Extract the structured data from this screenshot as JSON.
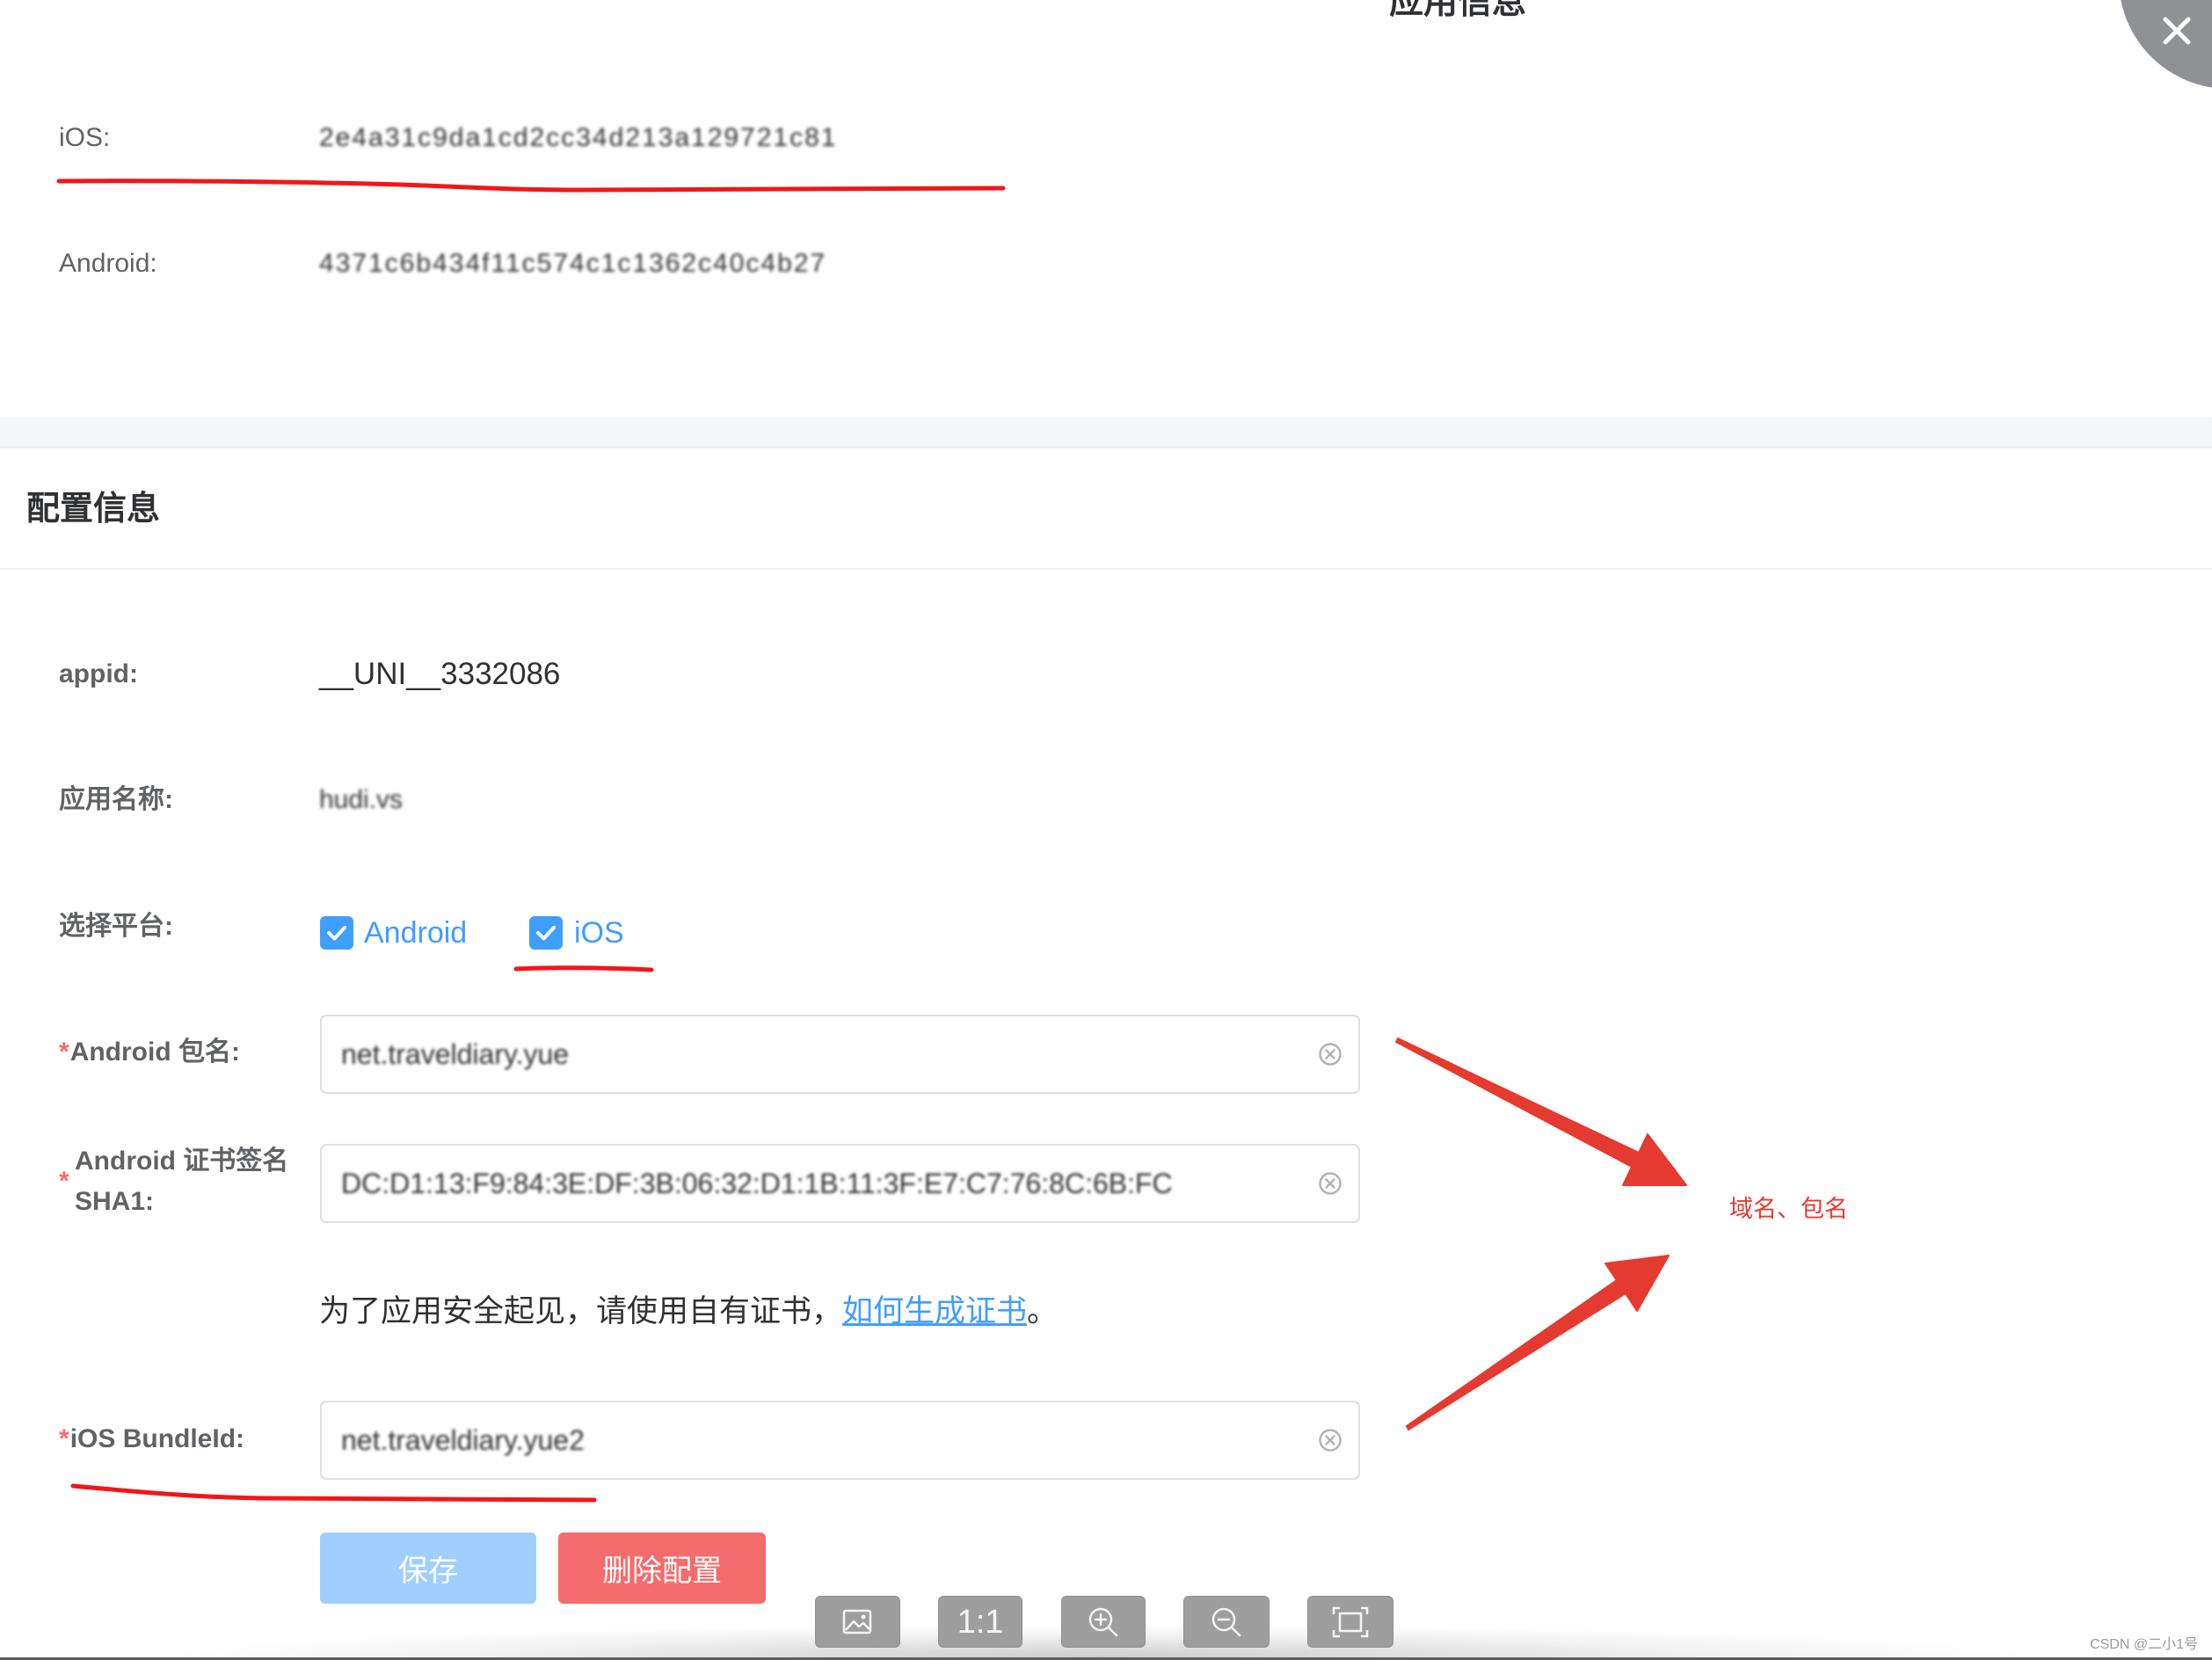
{
  "colors": {
    "primary": "#409eff",
    "primary_disabled": "#a0cfff",
    "danger": "#f56c6c",
    "annotation_red": "#e53a2f",
    "label_gray": "#606266",
    "text_dark": "#303133"
  },
  "app_info": {
    "title": "应用信息",
    "keys": [
      {
        "label": "iOS:",
        "value": "2e4a31c9da1cd2cc34d213a129721c81"
      },
      {
        "label": "Android:",
        "value": "4371c6b434f11c574c1c1362c40c4b27"
      }
    ]
  },
  "dialog": {
    "close_icon": "close-icon"
  },
  "config": {
    "title": "配置信息",
    "appid": {
      "label": "appid:",
      "value": "__UNI__3332086"
    },
    "app_name": {
      "label": "应用名称:",
      "value": "hudi.vs"
    },
    "platform": {
      "label": "选择平台:",
      "options": [
        {
          "label": "Android",
          "checked": true
        },
        {
          "label": "iOS",
          "checked": true
        }
      ]
    },
    "android_package": {
      "required_mark": "*",
      "label": "Android 包名:",
      "value": "net.traveldiary.yue",
      "clear_icon": "circle-close-icon"
    },
    "android_sha1": {
      "required_mark": "*",
      "label_line1": "Android 证书签名",
      "label_line2": "SHA1:",
      "value": "DC:D1:13:F9:84:3E:DF:3B:06:32:D1:1B:11:3F:E7:C7:76:8C:6B:FC",
      "clear_icon": "circle-close-icon"
    },
    "cert_hint": {
      "text": "为了应用安全起见，请使用自有证书，",
      "link": "如何生成证书",
      "suffix": "。"
    },
    "ios_bundle_id": {
      "required_mark": "*",
      "label": "iOS BundleId:",
      "value": "net.traveldiary.yue2",
      "clear_icon": "circle-close-icon"
    },
    "actions": {
      "save": {
        "label": "保存",
        "disabled": true
      },
      "delete": {
        "label": "删除配置"
      }
    }
  },
  "annotation": {
    "text": "域名、包名"
  },
  "image_viewer_toolbar": {
    "buttons": [
      {
        "icon": "image-icon"
      },
      {
        "label": "1:1"
      },
      {
        "icon": "zoom-in-icon"
      },
      {
        "icon": "zoom-out-icon"
      },
      {
        "icon": "fit-screen-icon"
      }
    ]
  },
  "watermark": "CSDN @二小1号"
}
